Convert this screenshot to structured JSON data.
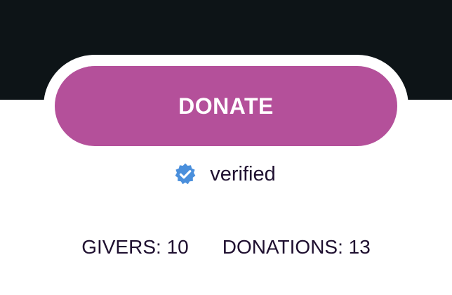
{
  "colors": {
    "header_background": "#0d1417",
    "donate_button": "#b4509a",
    "verified_badge": "#4a8fdc",
    "text": "#1f1030"
  },
  "donate": {
    "label": "DONATE"
  },
  "verification": {
    "icon": "verified-badge-icon",
    "label": "verified"
  },
  "stats": {
    "givers_label": "GIVERS:",
    "givers_value": "10",
    "donations_label": "DONATIONS:",
    "donations_value": "13"
  }
}
